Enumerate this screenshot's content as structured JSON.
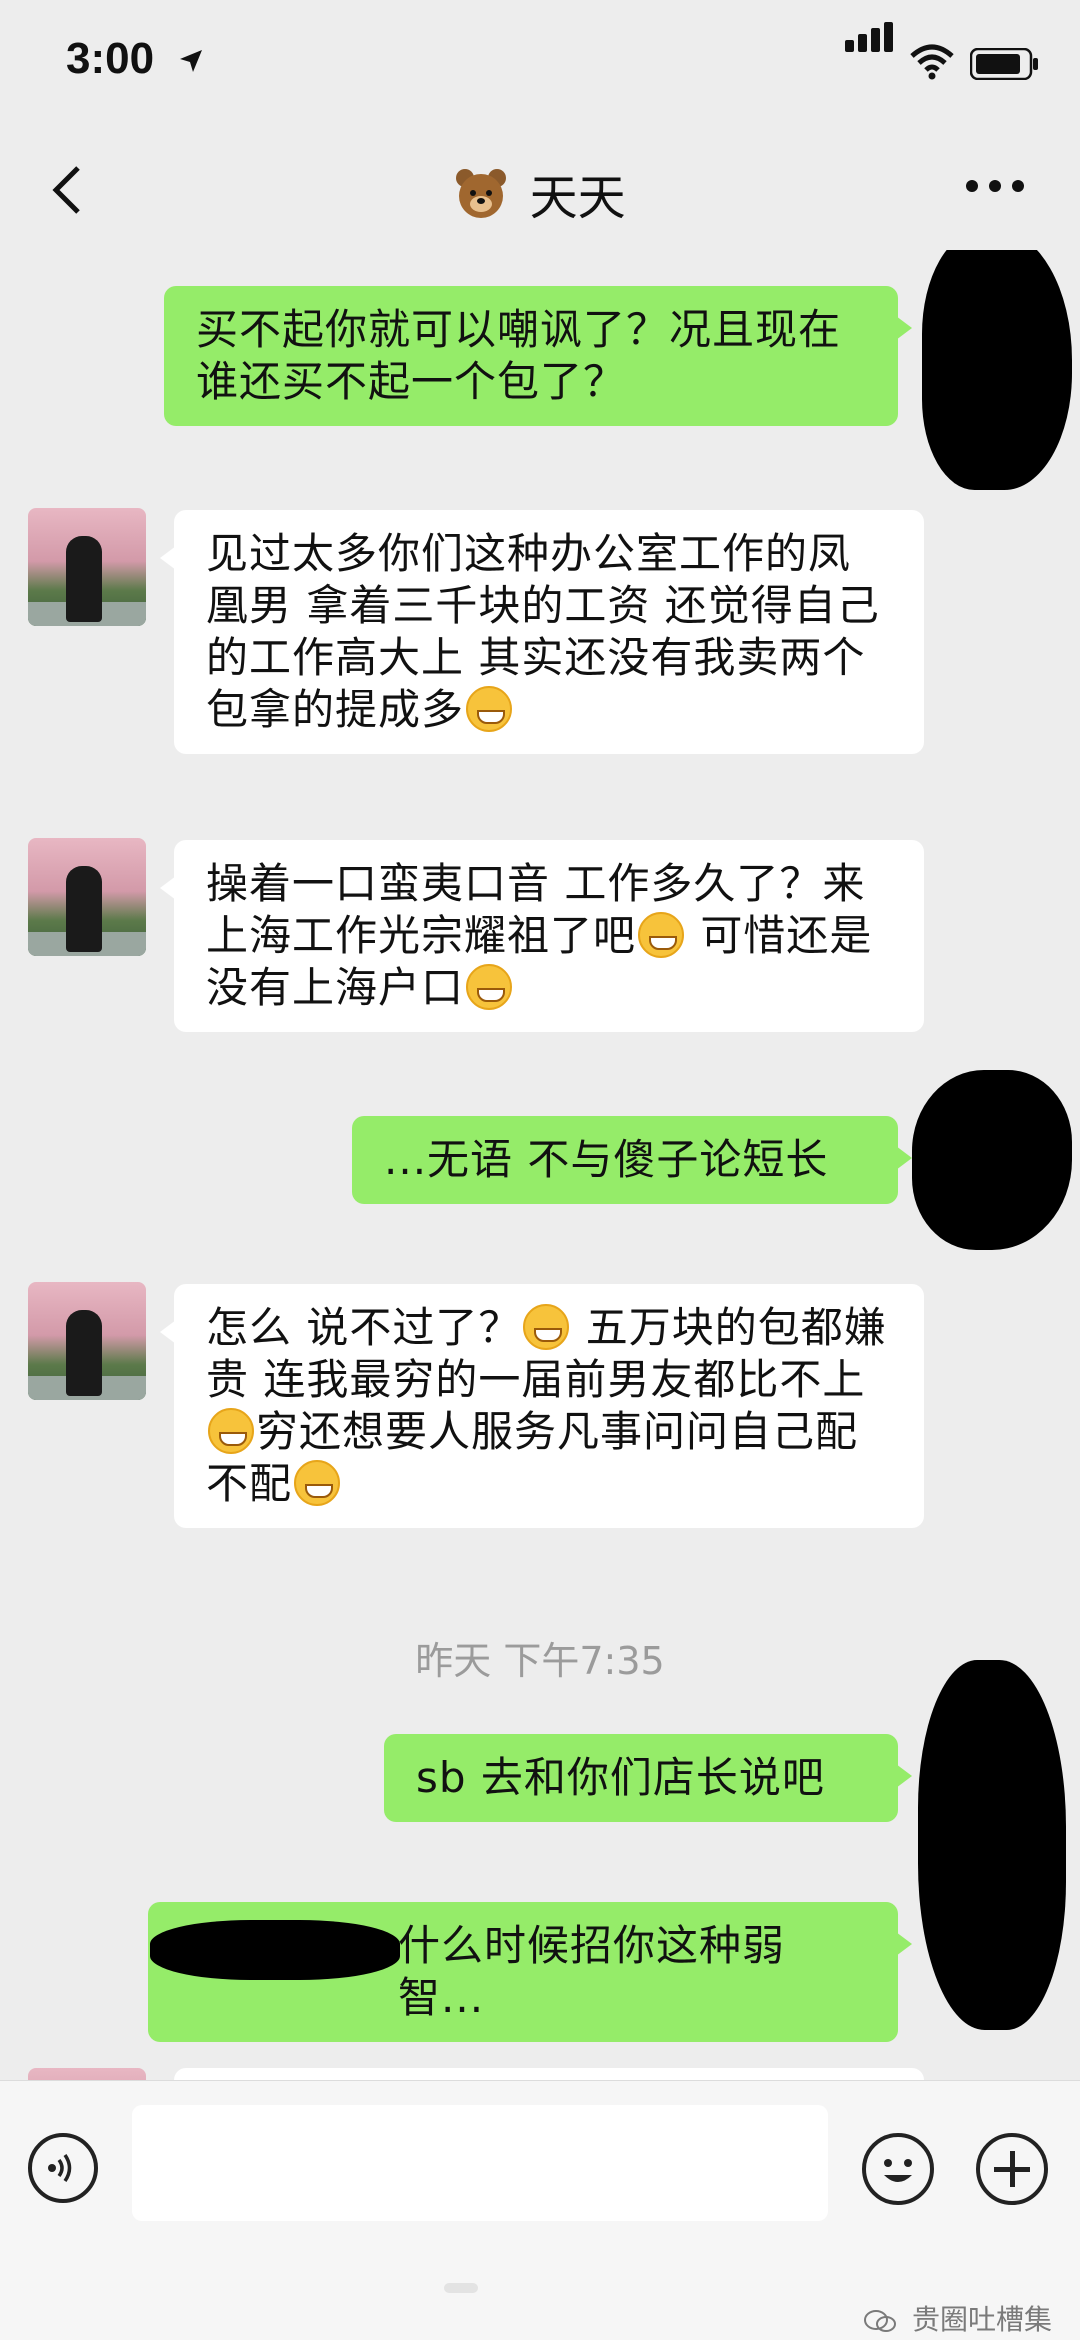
{
  "status_bar": {
    "time": "3:00"
  },
  "nav": {
    "title": "天天"
  },
  "messages": [
    {
      "text": "买不起你就可以嘲讽了？况且现在谁还买不起一个包了？"
    },
    {
      "text_html": "见过太多你们这种办公室工作的凤凰男 拿着三千块的工资 还觉得自己的工作高大上 其实还没有我卖两个包拿的提成多"
    },
    {
      "text": "操着一口蛮夷口音 工作多久了？来上海工作光宗耀祖了吧",
      "text_b": "可惜还是没有上海户口"
    },
    {
      "text": "...无语 不与傻子论短长"
    },
    {
      "text": "怎么 说不过了？",
      "text_b": "五万块的包都嫌贵 连我最穷的一届前男友都比不上",
      "text_c": "穷还想要人服务凡事问问自己配不配"
    },
    {
      "text": "sb 去和你们店长说吧"
    },
    {
      "text": "什么时候招你这种弱智..."
    }
  ],
  "timestamp": "昨天 下午7:35",
  "watermark": "贵圈吐槽集"
}
